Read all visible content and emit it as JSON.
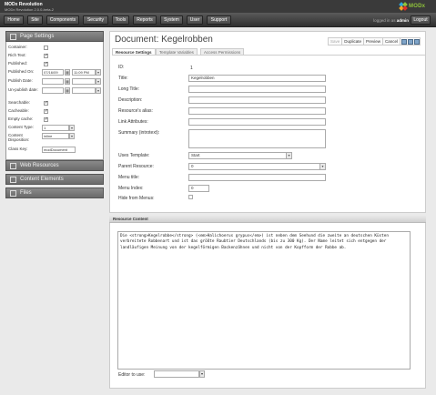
{
  "app": {
    "title": "MODx Revolution",
    "version": "MODx Revolution 2.0.0-beta-2",
    "logo_text": "MODx",
    "logged_in_label": "logged in as",
    "user": "admin",
    "logout": "Logout"
  },
  "nav": [
    "Home",
    "Site",
    "Components",
    "Security",
    "Tools",
    "Reports",
    "System",
    "User",
    "Support"
  ],
  "left": {
    "page_settings": "Page Settings",
    "fields": {
      "container": "Container:",
      "rich_text": "Rich Text:",
      "published": "Published:",
      "published_on": "Published On:",
      "published_on_date": "07/16/09",
      "published_on_time": "11:09 PM",
      "publish_date": "Publish Date:",
      "unpublish_date": "Un-publish date:",
      "searchable": "Searchable:",
      "cacheable": "Cacheable:",
      "empty_cache": "Empty cache:",
      "content_type": "Content Type:",
      "content_type_value": "1",
      "content_disposition": "Content Disposition:",
      "content_disposition_value": "inline",
      "class_key": "Class Key:",
      "class_key_value": "modDocument"
    },
    "web_resources": "Web Resources",
    "content_elements": "Content Elements",
    "files": "Files"
  },
  "document": {
    "title": "Document: Kegelrobben",
    "actions": [
      "Save",
      "Duplicate",
      "Preview",
      "Cancel"
    ],
    "tabs": [
      "Resource Settings",
      "Template Variables",
      "Access Permissions"
    ],
    "labels": {
      "id": "ID:",
      "title": "Title:",
      "long_title": "Long Title:",
      "description": "Description:",
      "alias": "Resource's alias:",
      "link_attributes": "Link Attributes:",
      "summary": "Summary (introtext):",
      "template": "Uses Template:",
      "parent": "Parent Resource:",
      "menu_title": "Menu title:",
      "menu_index": "Menu Index:",
      "hide_menu": "Hide from Menus:"
    },
    "values": {
      "id": "1",
      "title": "Kegelrobben",
      "template": "Start",
      "parent": "0",
      "menu_index": "0"
    }
  },
  "resource_content": {
    "header": "Resource Content",
    "text": "Die <strong>Kegelrobbe</strong> (<em>Halichoerus grypus</em>) ist neben dem Seehund die zweite an deutschen Küsten verbreitete Robbenart und ist das größte Raubtier Deutschlands (bis zu 300 Kg). Der Name leitet sich entgegen der landläufigen Meinung von der kegelförmigen Backenzähnen und nicht von der Kopfform der Robbe ab.",
    "editor_label": "Editor to use:"
  },
  "colors": {
    "accent": "#8fc43a",
    "nav_dark": "#3a3a3a",
    "panel_header": "#7a7a7a"
  }
}
